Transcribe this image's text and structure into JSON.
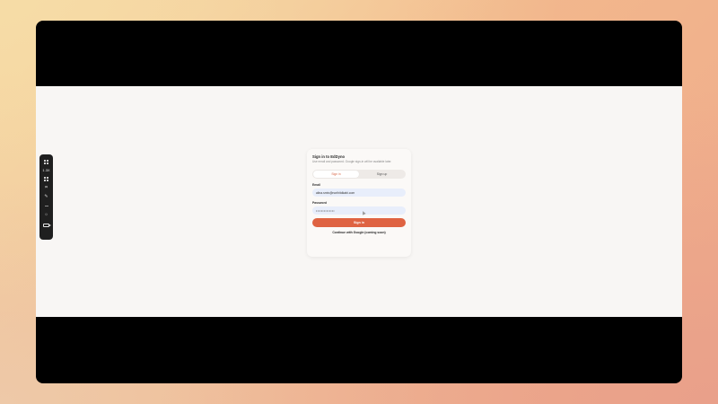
{
  "toolbar": {
    "zoom": "1.3X",
    "icons": [
      "grid-icon",
      "apps-icon",
      "crop-icon",
      "pen-icon",
      "dots-icon",
      "sun-icon",
      "camera-icon"
    ]
  },
  "signin": {
    "title": "Sign in to EdDyno",
    "subtitle": "Use email and password. Google sign-in will be available later.",
    "tabs": [
      "Sign in",
      "Sign up"
    ],
    "active_tab": "Sign in",
    "email_label": "Email",
    "email_value": "alina.smiv@norihitdkabi.com",
    "password_label": "Password",
    "password_value": "••••••••••••••",
    "submit_label": "Sign in",
    "google_label": "Continue with Google (coming soon)"
  },
  "colors": {
    "accent": "#df6342",
    "field_bg": "#e8eefb",
    "canvas_bg": "#f8f6f4"
  }
}
